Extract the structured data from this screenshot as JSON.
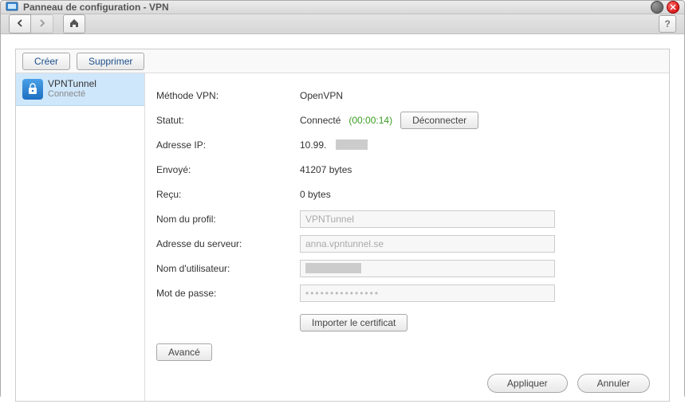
{
  "window": {
    "title": "Panneau de configuration - VPN"
  },
  "toolbar": {
    "help_label": "?"
  },
  "panel": {
    "create_label": "Créer",
    "delete_label": "Supprimer"
  },
  "sidebar": {
    "profile": {
      "name": "VPNTunnel",
      "status": "Connecté"
    }
  },
  "details": {
    "method_label": "Méthode VPN:",
    "method_value": "OpenVPN",
    "status_label": "Statut:",
    "status_value": "Connecté",
    "status_duration": "(00:00:14)",
    "disconnect_label": "Déconnecter",
    "ip_label": "Adresse IP:",
    "ip_value": "10.99.",
    "sent_label": "Envoyé:",
    "sent_value": "41207 bytes",
    "recv_label": "Reçu:",
    "recv_value": "0 bytes",
    "profile_name_label": "Nom du profil:",
    "profile_name_value": "VPNTunnel",
    "server_label": "Adresse du serveur:",
    "server_value": "anna.vpntunnel.se",
    "username_label": "Nom d'utilisateur:",
    "password_label": "Mot de passe:",
    "password_value": "•••••••••••••••",
    "import_cert_label": "Importer le certificat",
    "advanced_label": "Avancé"
  },
  "footer": {
    "apply_label": "Appliquer",
    "cancel_label": "Annuler"
  }
}
